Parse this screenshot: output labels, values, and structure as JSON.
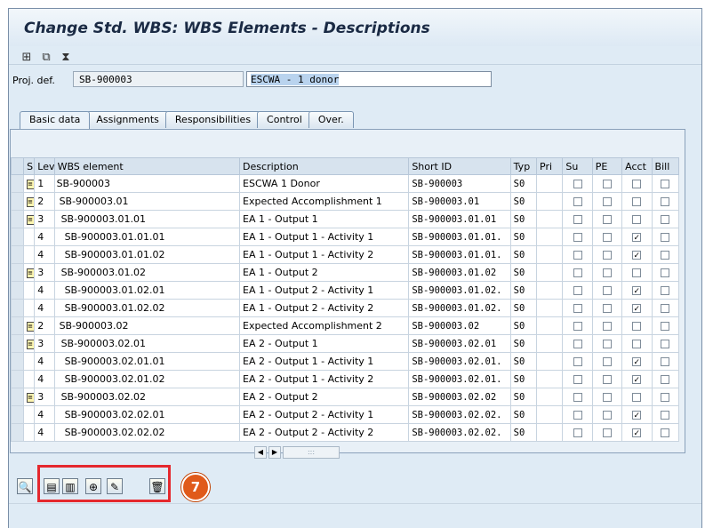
{
  "window": {
    "title": "Change Std. WBS: WBS Elements - Descriptions"
  },
  "toolbar_icons": [
    "hierarchy-icon",
    "structure-icon",
    "filter-icon"
  ],
  "project": {
    "label": "Proj. def.",
    "id": "SB-900003",
    "description": "ESCWA - 1 donor"
  },
  "tabs": [
    "Basic data",
    "Assignments",
    "Responsibilities",
    "Control",
    "Over."
  ],
  "table": {
    "headers": [
      "S",
      "Lev",
      "WBS element",
      "Description",
      "Short ID",
      "Typ",
      "Pri",
      "Su",
      "PE",
      "Acct",
      "Bill"
    ],
    "rows": [
      {
        "lev": "1",
        "wbs": "SB-900003",
        "desc": "ESCWA 1 Donor",
        "short": "SB-900003",
        "typ": "S0",
        "acct": false
      },
      {
        "lev": "2",
        "wbs": "SB-900003.01",
        "desc": "Expected Accomplishment 1",
        "short": "SB-900003.01",
        "typ": "S0",
        "acct": false
      },
      {
        "lev": "3",
        "wbs": "SB-900003.01.01",
        "desc": "EA 1 - Output 1",
        "short": "SB-900003.01.01",
        "typ": "S0",
        "acct": false
      },
      {
        "lev": "4",
        "wbs": "SB-900003.01.01.01",
        "desc": "EA 1 - Output 1 - Activity 1",
        "short": "SB-900003.01.01.",
        "typ": "S0",
        "acct": true
      },
      {
        "lev": "4",
        "wbs": "SB-900003.01.01.02",
        "desc": "EA 1 - Output 1 - Activity 2",
        "short": "SB-900003.01.01.",
        "typ": "S0",
        "acct": true
      },
      {
        "lev": "3",
        "wbs": "SB-900003.01.02",
        "desc": "EA 1 - Output 2",
        "short": "SB-900003.01.02",
        "typ": "S0",
        "acct": false
      },
      {
        "lev": "4",
        "wbs": "SB-900003.01.02.01",
        "desc": "EA 1 - Output 2 - Activity 1",
        "short": "SB-900003.01.02.",
        "typ": "S0",
        "acct": true
      },
      {
        "lev": "4",
        "wbs": "SB-900003.01.02.02",
        "desc": "EA 1 - Output 2 - Activity 2",
        "short": "SB-900003.01.02.",
        "typ": "S0",
        "acct": true
      },
      {
        "lev": "2",
        "wbs": "SB-900003.02",
        "desc": "Expected Accomplishment 2",
        "short": "SB-900003.02",
        "typ": "S0",
        "acct": false
      },
      {
        "lev": "3",
        "wbs": "SB-900003.02.01",
        "desc": "EA 2 - Output 1",
        "short": "SB-900003.02.01",
        "typ": "S0",
        "acct": false
      },
      {
        "lev": "4",
        "wbs": "SB-900003.02.01.01",
        "desc": "EA 2 - Output 1 - Activity 1",
        "short": "SB-900003.02.01.",
        "typ": "S0",
        "acct": true
      },
      {
        "lev": "4",
        "wbs": "SB-900003.02.01.02",
        "desc": "EA 2 - Output 1 - Activity 2",
        "short": "SB-900003.02.01.",
        "typ": "S0",
        "acct": true
      },
      {
        "lev": "3",
        "wbs": "SB-900003.02.02",
        "desc": "EA 2 - Output 2",
        "short": "SB-900003.02.02",
        "typ": "S0",
        "acct": false
      },
      {
        "lev": "4",
        "wbs": "SB-900003.02.02.01",
        "desc": "EA 2 - Output 2 - Activity 1",
        "short": "SB-900003.02.02.",
        "typ": "S0",
        "acct": true
      },
      {
        "lev": "4",
        "wbs": "SB-900003.02.02.02",
        "desc": "EA 2 - Output 2 - Activity 2",
        "short": "SB-900003.02.02.",
        "typ": "S0",
        "acct": true
      }
    ]
  },
  "bottom_toolbar_icons": [
    "zoom-icon",
    "select-all-icon",
    "deselect-icon",
    "insert-row-icon",
    "edit-icon",
    "delete-icon"
  ],
  "callout": {
    "number": "7"
  },
  "colors": {
    "highlight_box": "#e5282e",
    "callout_badge": "#e05a1a"
  }
}
